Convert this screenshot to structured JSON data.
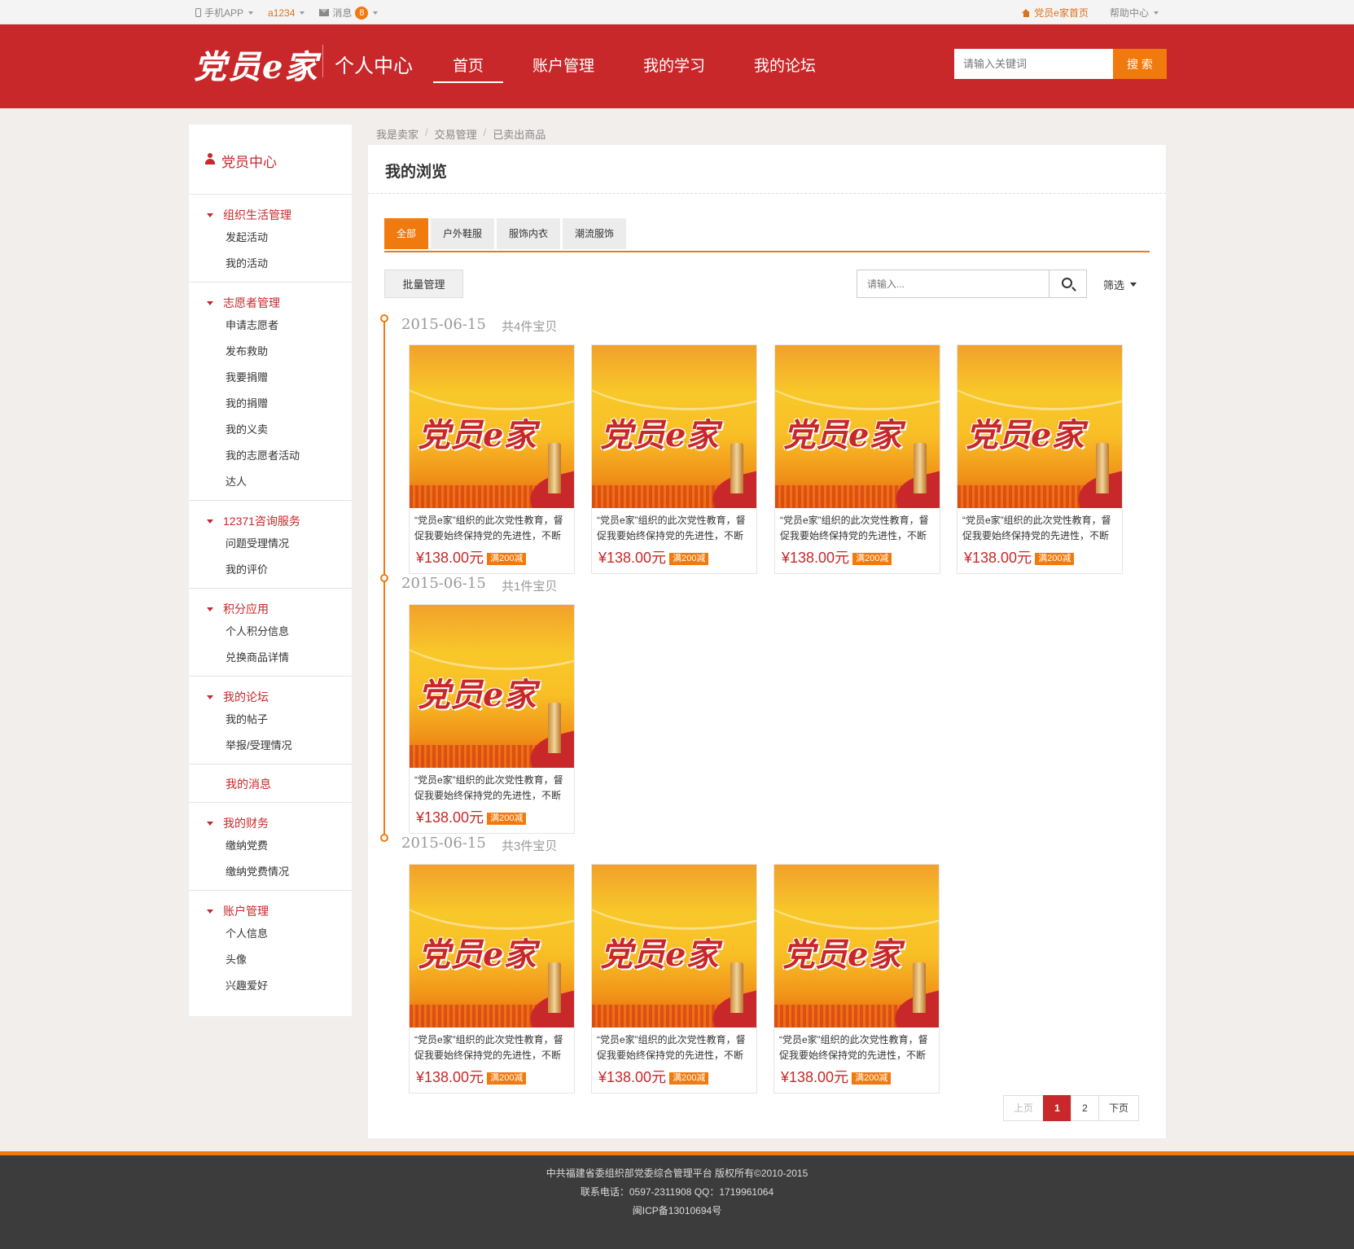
{
  "topbar": {
    "app": "手机APP",
    "user": "a1234",
    "messages_label": "消息",
    "messages_count": "8",
    "home_link": "党员e家首页",
    "help": "帮助中心"
  },
  "header": {
    "logo": "党员e家",
    "subtitle": "个人中心",
    "nav": [
      "首页",
      "账户管理",
      "我的学习",
      "我的论坛"
    ],
    "search_placeholder": "请输入关键词",
    "search_button": "搜 索"
  },
  "sidebar": {
    "title": "党员中心",
    "groups": [
      {
        "title": "组织生活管理",
        "items": [
          "发起活动",
          "我的活动"
        ]
      },
      {
        "title": "志愿者管理",
        "items": [
          "申请志愿者",
          "发布救助",
          "我要捐赠",
          "我的捐赠",
          "我的义卖",
          "我的志愿者活动",
          "达人"
        ]
      },
      {
        "title": "12371咨询服务",
        "items": [
          "问题受理情况",
          "我的评价"
        ]
      },
      {
        "title": "积分应用",
        "items": [
          "个人积分信息",
          "兑换商品详情"
        ]
      },
      {
        "title": "我的论坛",
        "items": [
          "我的帖子",
          "举报/受理情况"
        ]
      },
      {
        "title": "我的消息",
        "items": []
      },
      {
        "title": "我的财务",
        "items": [
          "缴纳党费",
          "缴纳党费情况"
        ]
      },
      {
        "title": "账户管理",
        "items": [
          "个人信息",
          "头像",
          "兴趣爱好"
        ]
      }
    ]
  },
  "breadcrumb": [
    "我是卖家",
    "交易管理",
    "已卖出商品"
  ],
  "main": {
    "title": "我的浏览",
    "tabs": [
      "全部",
      "户外鞋服",
      "服饰内衣",
      "潮流服饰"
    ],
    "batch_button": "批量管理",
    "filter_placeholder": "请输入...",
    "sort_label": "筛选",
    "groups": [
      {
        "date": "2015-06-15",
        "count": "共4件宝贝"
      },
      {
        "date": "2015-06-15",
        "count": "共1件宝贝"
      },
      {
        "date": "2015-06-15",
        "count": "共3件宝贝"
      }
    ],
    "product": {
      "image_text": "党员e家",
      "desc": "“党员e家”组织的此次党性教育，督促我要始终保持党的先进性，不断",
      "price": "¥138.00元",
      "promo": "满200减"
    },
    "pagination": [
      "上页",
      "1",
      "2",
      "下页"
    ]
  },
  "footer": {
    "line1": "中共福建省委组织部党委综合管理平台 版权所有©2010-2015",
    "line2": "联系电话：0597-2311908     QQ：1719961064",
    "line3": "闽ICP备13010694号"
  },
  "colors": {
    "brand_red": "#c8282a",
    "accent_orange": "#f07a0e",
    "footer_bg": "#3c3c3c"
  }
}
